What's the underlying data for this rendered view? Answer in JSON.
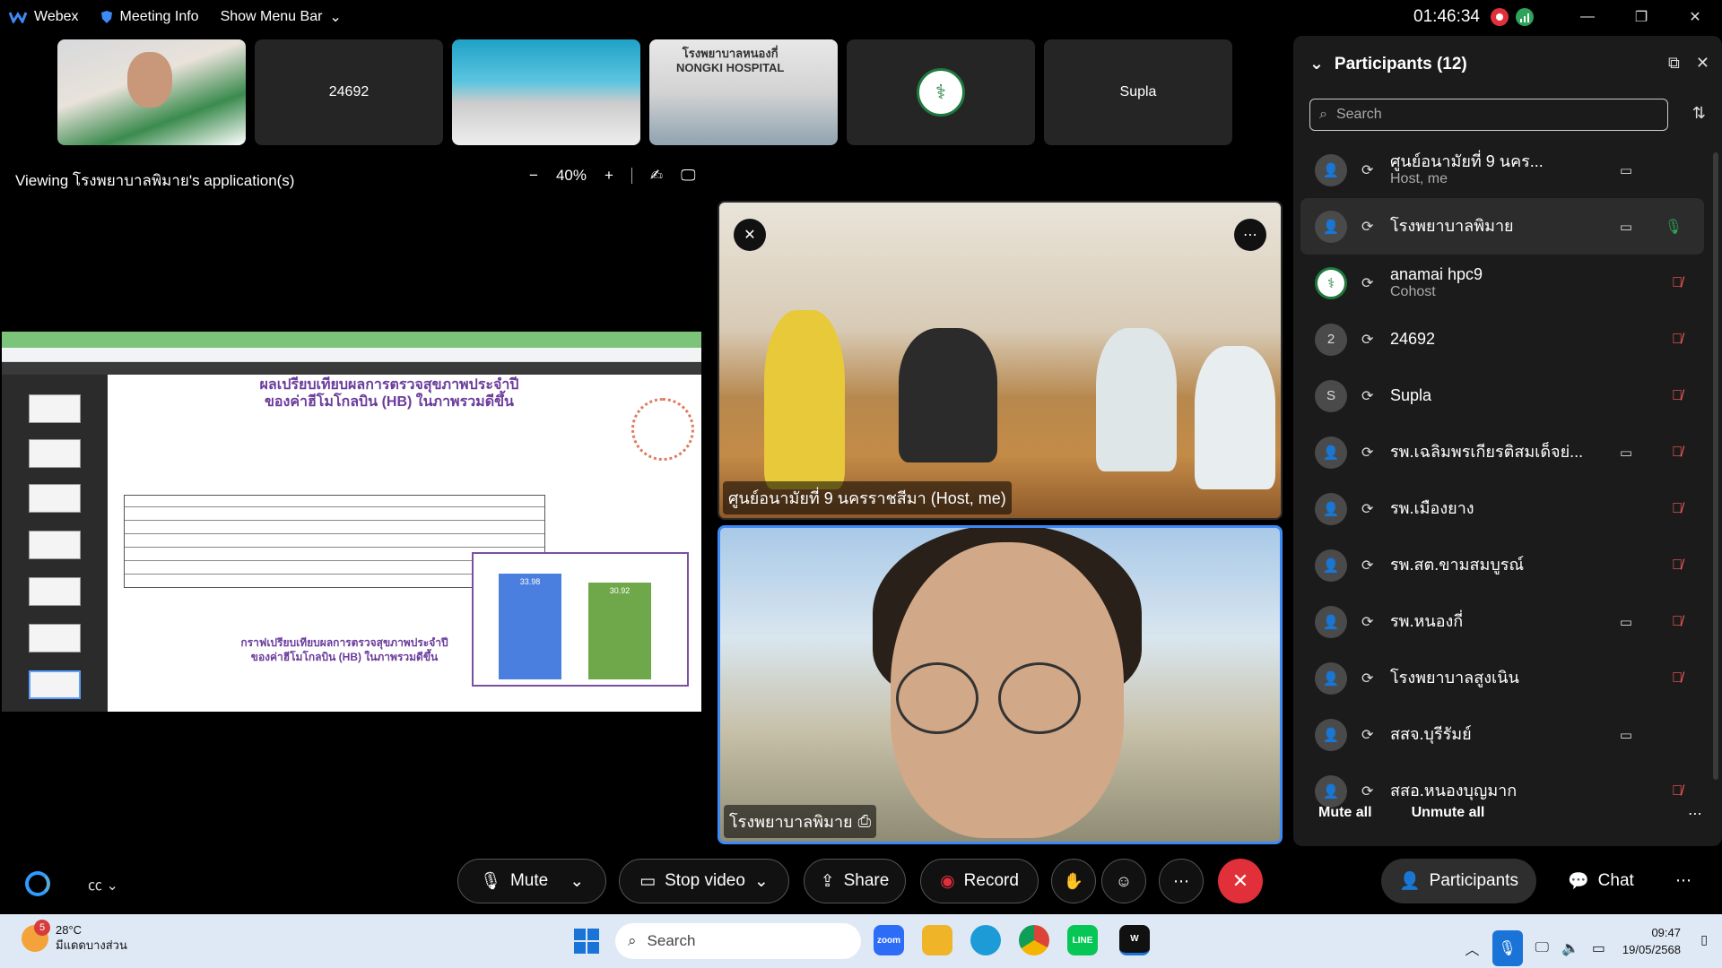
{
  "titlebar": {
    "app_name": "Webex",
    "meeting_info": "Meeting Info",
    "show_menu_bar": "Show Menu Bar",
    "clock": "01:46:34"
  },
  "thumbnails": [
    {
      "label": ""
    },
    {
      "label": "24692"
    },
    {
      "label": ""
    },
    {
      "label": "โรงพยาบาลหนองกี่\nNONGKI HOSPITAL"
    },
    {
      "label": ""
    },
    {
      "label": "Supla"
    }
  ],
  "viewing": {
    "text": "Viewing โรงพยาบาลพิมาย's application(s)",
    "zoom_minus": "−",
    "zoom_level": "40%",
    "zoom_plus": "+"
  },
  "shared_doc": {
    "title_line1": "ผลเปรียบเทียบผลการตรวจสุขภาพประจำปี",
    "title_line2": "ของค่าฮีโมโกลบิน (HB) ในภาพรวมดีขึ้น",
    "subtitle_line1": "กราฟเปรียบเทียบผลการตรวจสุขภาพประจำปี",
    "subtitle_line2": "ของค่าฮีโมโกลบิน (HB) ในภาพรวมดีขึ้น",
    "chart_bar1": "33.98",
    "chart_bar2": "30.92"
  },
  "videos": {
    "tile1_name": "ศูนย์อนามัยที่ 9 นครราชสีมา (Host, me)",
    "tile2_name": "โรงพยาบาลพิมาย"
  },
  "participants": {
    "header": "Participants (12)",
    "search_placeholder": "Search",
    "items": [
      {
        "name": "ศูนย์อนามัยที่ 9 นคร...",
        "role": "Host, me",
        "avatar": "",
        "cam": true,
        "mic": ""
      },
      {
        "name": "โรงพยาบาลพิมาย",
        "role": "",
        "avatar": "",
        "cam": true,
        "mic": "live"
      },
      {
        "name": "anamai hpc9",
        "role": "Cohost",
        "avatar": "logo",
        "cam": false,
        "mic": "muted"
      },
      {
        "name": "24692",
        "role": "",
        "avatar": "2",
        "cam": false,
        "mic": "muted"
      },
      {
        "name": "Supla",
        "role": "",
        "avatar": "S",
        "cam": false,
        "mic": "muted"
      },
      {
        "name": "รพ.เฉลิมพรเกียรติสมเด็จย่...",
        "role": "",
        "avatar": "",
        "cam": true,
        "mic": "muted"
      },
      {
        "name": "รพ.เมืองยาง",
        "role": "",
        "avatar": "",
        "cam": false,
        "mic": "muted"
      },
      {
        "name": "รพ.สต.ขามสมบูรณ์",
        "role": "",
        "avatar": "",
        "cam": false,
        "mic": "muted"
      },
      {
        "name": "รพ.หนองกี่",
        "role": "",
        "avatar": "",
        "cam": true,
        "mic": "muted"
      },
      {
        "name": "โรงพยาบาลสูงเนิน",
        "role": "",
        "avatar": "",
        "cam": false,
        "mic": "muted"
      },
      {
        "name": "สสจ.บุรีรัมย์",
        "role": "",
        "avatar": "",
        "cam": true,
        "mic": ""
      },
      {
        "name": "สสอ.หนองบุญมาก",
        "role": "",
        "avatar": "",
        "cam": false,
        "mic": "muted"
      }
    ],
    "mute_all": "Mute all",
    "unmute_all": "Unmute all"
  },
  "controls": {
    "mute": "Mute",
    "stop_video": "Stop video",
    "share": "Share",
    "record": "Record",
    "participants_tab": "Participants",
    "chat_tab": "Chat"
  },
  "taskbar": {
    "weather_badge": "5",
    "temperature": "28°C",
    "weather_desc": "มีแดดบางส่วน",
    "search": "Search",
    "time": "09:47",
    "date": "19/05/2568"
  },
  "colors": {
    "accent_blue": "#3d8af7",
    "leave_red": "#e2303a",
    "muted_red": "#ff5c5c",
    "live_green": "#2fa35a"
  }
}
